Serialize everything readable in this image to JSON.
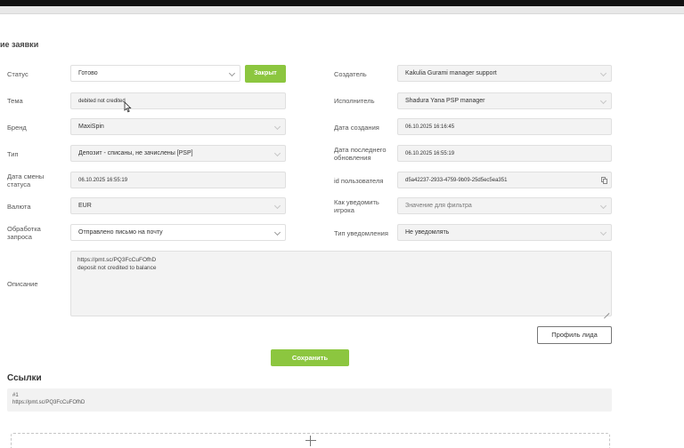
{
  "page": {
    "title": "ие заявки"
  },
  "form": {
    "status": {
      "label": "Статус",
      "value": "Готово",
      "button": "Закрыт"
    },
    "topic": {
      "label": "Тема",
      "value": "debited not credited"
    },
    "brand": {
      "label": "Бренд",
      "value": "MaxiSpin"
    },
    "type": {
      "label": "Тип",
      "value": "Депозит - списаны, не зачислены [PSP]"
    },
    "status_changed": {
      "label": "Дата смены статуса",
      "value": "06.10.2025 16:55:19"
    },
    "currency": {
      "label": "Валюта",
      "value": "EUR"
    },
    "processing": {
      "label": "Обработка запроса",
      "value": "Отправлено письмо на почту"
    },
    "creator": {
      "label": "Создатель",
      "value": "Kakulia Gurami manager support"
    },
    "assignee": {
      "label": "Исполнитель",
      "value": "Shadura Yana PSP manager"
    },
    "created": {
      "label": "Дата создания",
      "value": "06.10.2025 16:16:45"
    },
    "updated": {
      "label": "Дата последнего обновления",
      "value": "06.10.2025 16:55:19"
    },
    "user_id": {
      "label": "id пользователя",
      "value": "d5a42237-2933-4759-9b09-25d5ec5ea351"
    },
    "notify_how": {
      "label": "Как уведомить игрока",
      "placeholder": "Значение для фильтра"
    },
    "notify_type": {
      "label": "Тип уведомления",
      "value": "Не уведомлять"
    },
    "description": {
      "label": "Описание",
      "line1": "https://pmt.sc/PQ3FcCuFOfhD",
      "line2": "deposit not credited to balance"
    }
  },
  "buttons": {
    "lead_profile": "Профиль лида",
    "save": "Сохранить"
  },
  "links": {
    "title": "Ссылки",
    "index": "#1",
    "url": "https://pmt.sc/PQ3FcCuFOfhD"
  },
  "colors": {
    "accent": "#8cc63f",
    "field_bg": "#f3f3f3",
    "topbar": "#111111"
  }
}
